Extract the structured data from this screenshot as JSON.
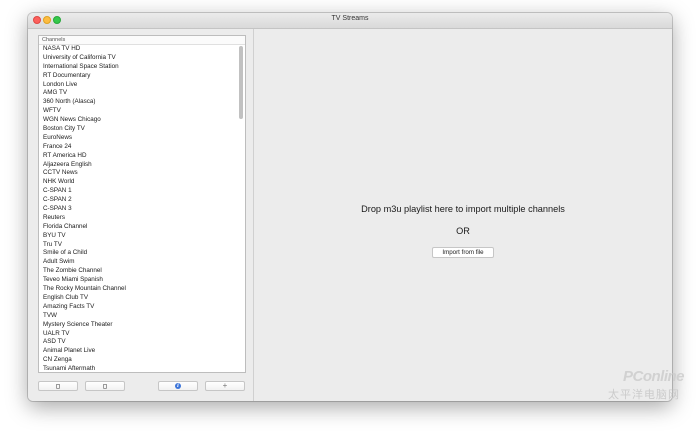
{
  "window": {
    "title": "TV Streams"
  },
  "sidebar": {
    "list_header": "Channels",
    "channels": [
      "NASA TV HD",
      "University of California TV",
      "International Space Station",
      "RT Documentary",
      "London Live",
      "AMG TV",
      "360 North (Alasca)",
      "WFTV",
      "WGN News Chicago",
      "Boston City TV",
      "EuroNews",
      "France 24",
      "RT America HD",
      "Aljazeera English",
      "CCTV News",
      "NHK World",
      "C-SPAN 1",
      "C-SPAN 2",
      "C-SPAN 3",
      "Reuters",
      "Florida Channel",
      "BYU TV",
      "Tru TV",
      "Smile of a Child",
      "Adult Swim",
      "The Zombie Channel",
      "Teveo Miami Spanish",
      "The Rocky Mountain Channel",
      "English Club TV",
      "Amazing Facts TV",
      "TVW",
      "Mystery Science Theater",
      "UALR TV",
      "ASD TV",
      "Animal Planet Live",
      "CN Zenga",
      "Tsunami Aftermath"
    ],
    "buttons": {
      "delete1_icon": "trash-icon",
      "delete2_icon": "trash-icon",
      "info_icon": "info-icon",
      "info_glyph": "i",
      "add_label": "+"
    }
  },
  "main": {
    "drop_text": "Drop m3u playlist here to import multiple channels",
    "or_text": "OR",
    "import_button": "Import from file"
  },
  "watermark": {
    "brand": "PConline",
    "sub": "太平洋电脑网"
  }
}
